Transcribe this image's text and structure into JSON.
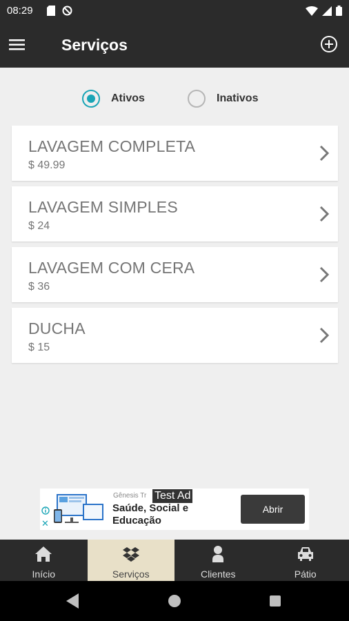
{
  "status_bar": {
    "time": "08:29"
  },
  "app_bar": {
    "title": "Serviços"
  },
  "filter": {
    "active_label": "Ativos",
    "inactive_label": "Inativos",
    "selected": "Ativos"
  },
  "services": [
    {
      "name": "LAVAGEM COMPLETA",
      "price": "$ 49.99"
    },
    {
      "name": "LAVAGEM SIMPLES",
      "price": "$ 24"
    },
    {
      "name": "LAVAGEM COM CERA",
      "price": "$ 36"
    },
    {
      "name": "DUCHA",
      "price": "$ 15"
    }
  ],
  "ad": {
    "advertiser": "Gênesis Tr",
    "test_label": "Test Ad",
    "headline": "Saúde, Social e Educação",
    "button": "Abrir"
  },
  "bottom_nav": [
    {
      "label": "Início",
      "icon": "home-icon",
      "active": false
    },
    {
      "label": "Serviços",
      "icon": "dropbox-icon",
      "active": true
    },
    {
      "label": "Clientes",
      "icon": "person-icon",
      "active": false
    },
    {
      "label": "Pátio",
      "icon": "car-icon",
      "active": false
    }
  ],
  "colors": {
    "bar": "#2b2b2b",
    "accent": "#1aa5b6",
    "active_tab": "#e8e0c8",
    "background": "#efefef"
  }
}
